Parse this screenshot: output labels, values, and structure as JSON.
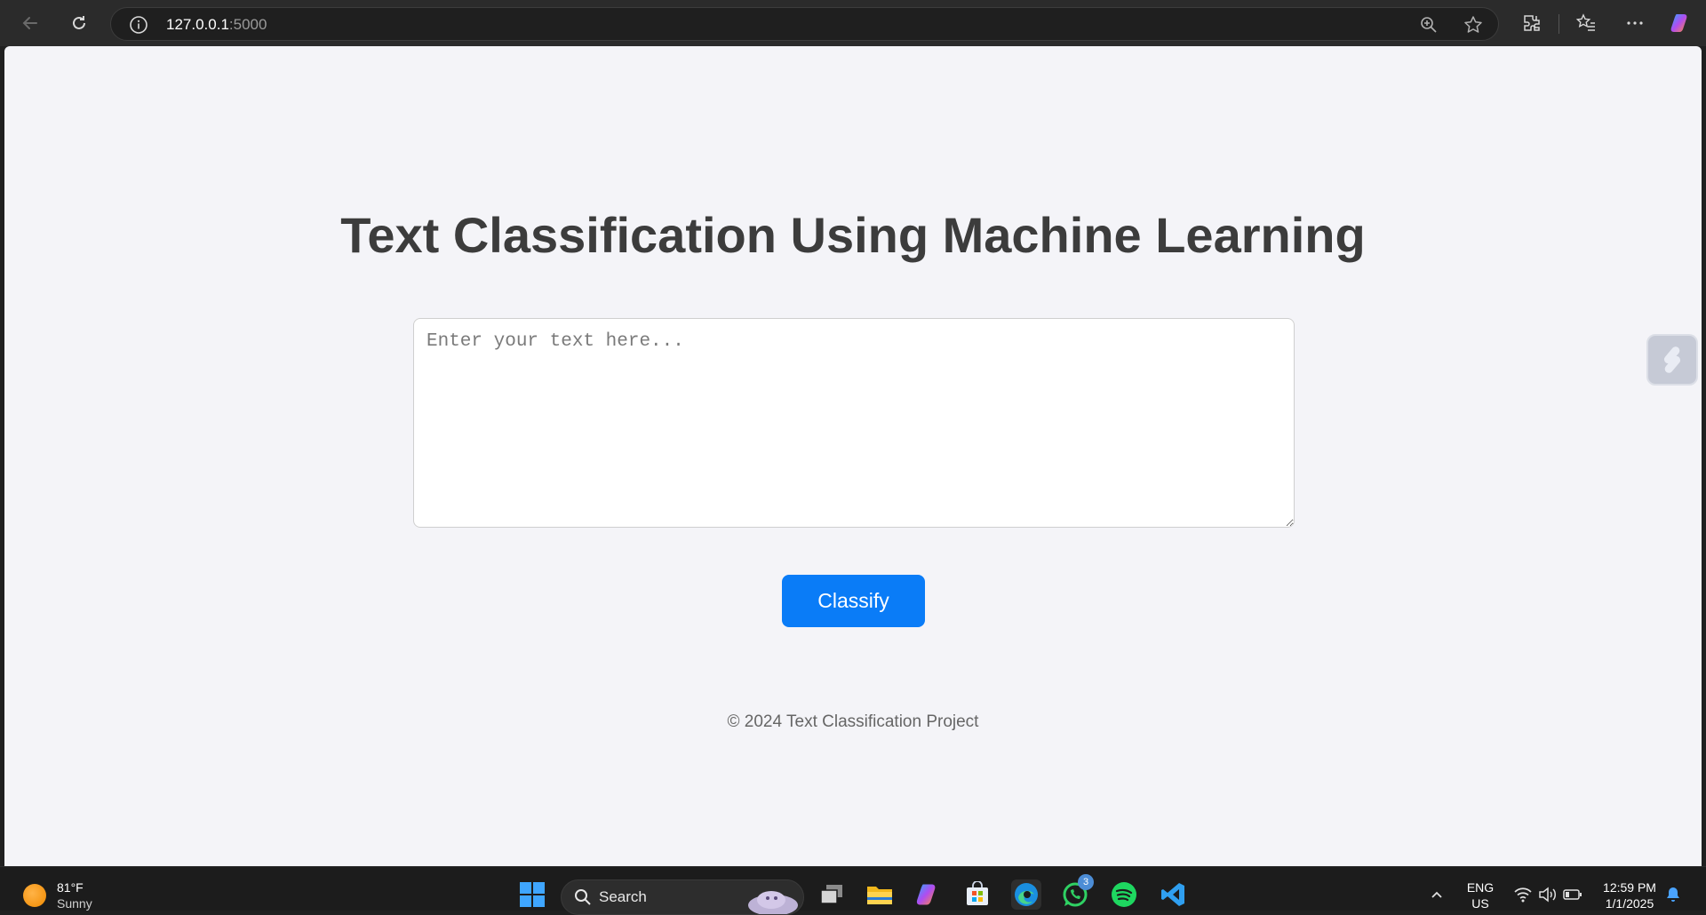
{
  "browser": {
    "url_host": "127.0.0.1",
    "url_port": ":5000"
  },
  "page": {
    "title": "Text Classification Using Machine Learning",
    "input_placeholder": "Enter your text here...",
    "classify_label": "Classify",
    "footer": "© 2024 Text Classification Project"
  },
  "taskbar": {
    "weather_temp": "81°F",
    "weather_condition": "Sunny",
    "search_label": "Search",
    "whatsapp_badge": "3",
    "lang_primary": "ENG",
    "lang_secondary": "US",
    "time": "12:59 PM",
    "date": "1/1/2025"
  },
  "colors": {
    "accent": "#0a7cf7",
    "page_background": "#f4f4f8",
    "title_text": "#3c3c3c"
  },
  "icons": [
    "back-arrow-icon",
    "refresh-icon",
    "site-info-icon",
    "zoom-icon",
    "favorite-star-icon",
    "extensions-icon",
    "favorites-list-icon",
    "more-options-icon",
    "copilot-icon",
    "windows-start-icon",
    "search-icon",
    "task-view-icon",
    "file-explorer-icon",
    "store-icon",
    "edge-icon",
    "whatsapp-icon",
    "spotify-icon",
    "vscode-icon",
    "chevron-up-icon",
    "wifi-icon",
    "volume-icon",
    "battery-icon",
    "notification-bell-icon"
  ]
}
